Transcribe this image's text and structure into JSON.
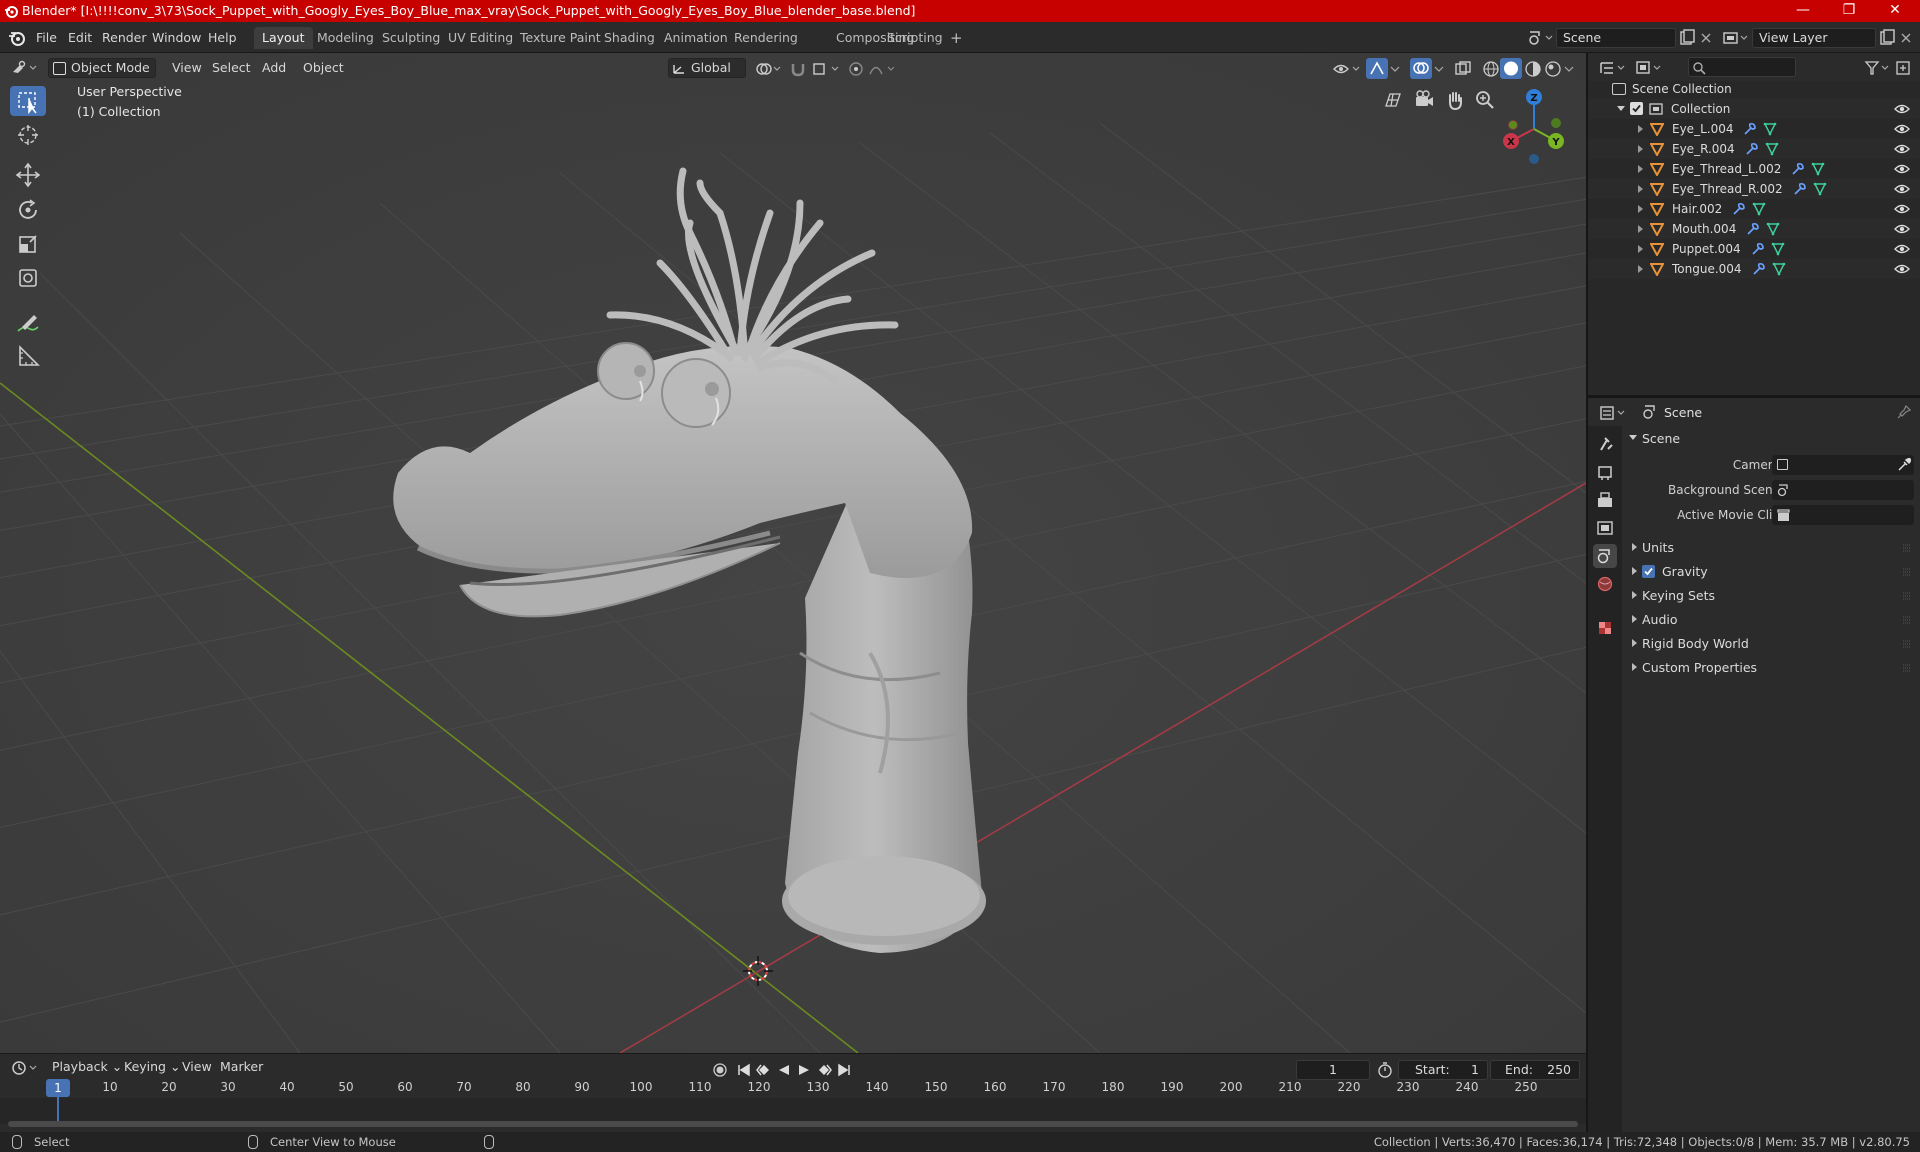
{
  "window": {
    "title": "Blender* [I:\\!!!!conv_3\\73\\Sock_Puppet_with_Googly_Eyes_Boy_Blue_max_vray\\Sock_Puppet_with_Googly_Eyes_Boy_Blue_blender_base.blend]",
    "minimize": "—",
    "maximize": "❐",
    "close": "✕"
  },
  "menu": [
    "File",
    "Edit",
    "Render",
    "Window",
    "Help"
  ],
  "workspaces": [
    "Layout",
    "Modeling",
    "Sculpting",
    "UV Editing",
    "Texture Paint",
    "Shading",
    "Animation",
    "Rendering",
    "Compositing",
    "Scripting",
    "+"
  ],
  "scene_selector": {
    "value": "Scene"
  },
  "view_layer": {
    "value": "View Layer"
  },
  "viewport_header": {
    "mode": "Object Mode",
    "menus": [
      "View",
      "Select",
      "Add",
      "Object"
    ],
    "transform_orientation": "Global"
  },
  "viewport": {
    "perspective": "User Perspective",
    "collection": "(1) Collection",
    "gizmo": {
      "x": "X",
      "y": "Y",
      "z": "Z"
    },
    "colors": {
      "background": "#3d3d3d",
      "grid": "#484848",
      "x_axis": "#a23b45",
      "y_axis": "#6b8a1f",
      "model": "#b9b9b9"
    }
  },
  "timeline": {
    "menus": [
      "Playback",
      "Keying",
      "View",
      "Marker"
    ],
    "current_frame": "1",
    "start_label": "Start:",
    "start": "1",
    "end_label": "End:",
    "end": "250",
    "ticks": [
      "1",
      "10",
      "20",
      "30",
      "40",
      "50",
      "60",
      "70",
      "80",
      "90",
      "100",
      "110",
      "120",
      "130",
      "140",
      "150",
      "160",
      "170",
      "180",
      "190",
      "200",
      "210",
      "220",
      "230",
      "240",
      "250"
    ]
  },
  "outliner": {
    "root": "Scene Collection",
    "collection": "Collection",
    "items": [
      "Eye_L.004",
      "Eye_R.004",
      "Eye_Thread_L.002",
      "Eye_Thread_R.002",
      "Hair.002",
      "Mouth.004",
      "Puppet.004",
      "Tongue.004"
    ]
  },
  "properties": {
    "context": "Scene",
    "section": "Scene",
    "fields": [
      {
        "label": "Camera"
      },
      {
        "label": "Background Scene"
      },
      {
        "label": "Active Movie Clip"
      }
    ],
    "panels": [
      "Units",
      "Gravity",
      "Keying Sets",
      "Audio",
      "Rigid Body World",
      "Custom Properties"
    ],
    "accent": "#4772b3"
  },
  "statusbar": {
    "left_action": "Select",
    "middle_action": "Center View to Mouse",
    "stats": "Collection | Verts:36,470 | Faces:36,174 | Tris:72,348 | Objects:0/8 | Mem: 35.7 MB | v2.80.75"
  }
}
